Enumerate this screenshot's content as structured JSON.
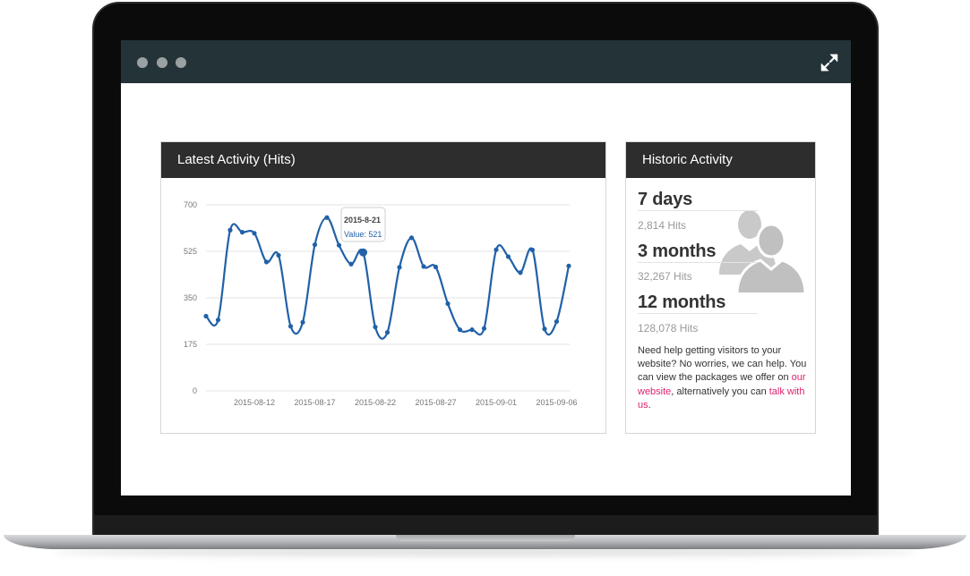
{
  "colors": {
    "titlebar": "#243337",
    "panel_header": "#2d2d2d",
    "line": "#2161a8",
    "link": "#e0226f"
  },
  "window": {
    "controls": [
      "dot",
      "dot",
      "dot"
    ],
    "expand_icon": "expand-arrows-icon"
  },
  "activity": {
    "title": "Latest Activity (Hits)",
    "tooltip": {
      "date": "2015-8-21",
      "value_label": "Value: 521"
    }
  },
  "chart_data": {
    "type": "line",
    "title": "Latest Activity (Hits)",
    "xlabel": "",
    "ylabel": "",
    "ylim": [
      0,
      700
    ],
    "yticks": [
      "0",
      "175",
      "350",
      "525",
      "700"
    ],
    "xticks": [
      "2015-08-12",
      "2015-08-17",
      "2015-08-22",
      "2015-08-27",
      "2015-09-01",
      "2015-09-06"
    ],
    "grid": true,
    "x": [
      "2015-08-08",
      "2015-08-09",
      "2015-08-10",
      "2015-08-11",
      "2015-08-12",
      "2015-08-13",
      "2015-08-14",
      "2015-08-15",
      "2015-08-16",
      "2015-08-17",
      "2015-08-18",
      "2015-08-19",
      "2015-08-20",
      "2015-08-21",
      "2015-08-22",
      "2015-08-23",
      "2015-08-24",
      "2015-08-25",
      "2015-08-26",
      "2015-08-27",
      "2015-08-28",
      "2015-08-29",
      "2015-08-30",
      "2015-08-31",
      "2015-09-01",
      "2015-09-02",
      "2015-09-03",
      "2015-09-04",
      "2015-09-05",
      "2015-09-06",
      "2015-09-07"
    ],
    "values": [
      281,
      267,
      605,
      597,
      593,
      485,
      510,
      243,
      258,
      550,
      652,
      548,
      477,
      521,
      240,
      220,
      465,
      576,
      468,
      466,
      328,
      230,
      230,
      235,
      531,
      505,
      445,
      530,
      233,
      261,
      470
    ]
  },
  "historic": {
    "title": "Historic Activity",
    "stats": [
      {
        "label": "7 days",
        "hits": "2,814 Hits"
      },
      {
        "label": "3 months",
        "hits": "32,267 Hits"
      },
      {
        "label": "12 months",
        "hits": "128,078 Hits"
      }
    ],
    "help": {
      "text1": "Need help getting visitors to your website? No worries, we can help. You can view the packages we offer on ",
      "link1": "our website",
      "text2": ", alternatively you can ",
      "link2": "talk with us",
      "text3": "."
    },
    "users_icon": "users-icon"
  }
}
